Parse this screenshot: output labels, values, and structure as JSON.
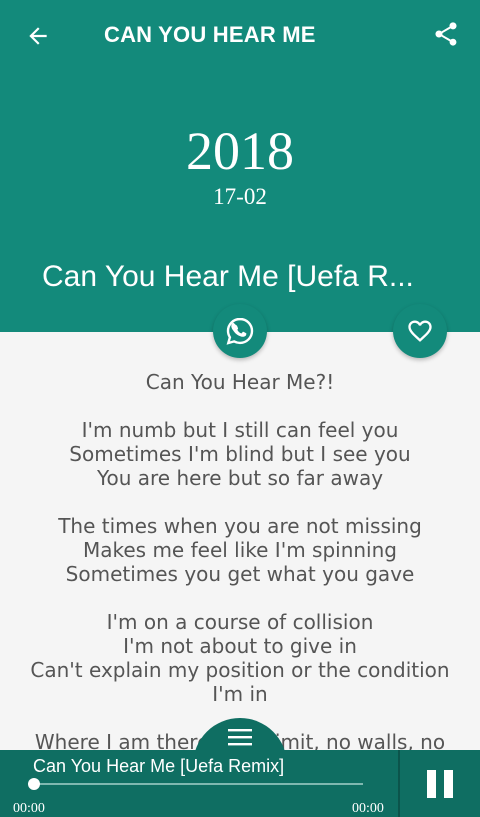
{
  "header": {
    "title": "CAN YOU HEAR ME",
    "year": "2018",
    "date": "17-02",
    "song_name": "Can You Hear Me [Uefa R...",
    "back_icon": "arrow-left-icon",
    "share_icon": "share-icon"
  },
  "actions": {
    "whatsapp_icon": "whatsapp-icon",
    "favorite_icon": "heart-outline-icon"
  },
  "lyrics": {
    "lines": [
      "Can You Hear Me?!",
      "",
      "I'm numb but I still can feel you",
      "Sometimes I'm blind but I see you",
      "You are here but so far away",
      "",
      "The times when you are not missing",
      "Makes me feel like I'm spinning",
      "Sometimes you get what you gave",
      "",
      "I'm on a course of collision",
      "I'm not about to give in",
      "Can't explain my position or the condition",
      "I'm in",
      "",
      "Where I am there is no limit, no walls, no"
    ]
  },
  "player": {
    "title": "Can You Hear Me [Uefa Remix]",
    "current_time": "00:00",
    "total_time": "00:00",
    "progress": 0,
    "menu_icon": "menu-icon",
    "pause_icon": "pause-icon"
  },
  "colors": {
    "primary": "#138a7b",
    "primary_dark": "#0f6e62",
    "lyrics_text": "#555555"
  }
}
